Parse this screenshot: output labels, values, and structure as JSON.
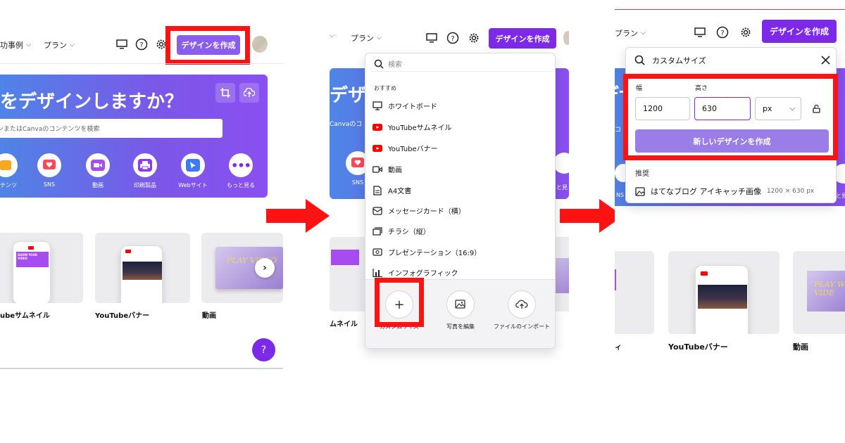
{
  "nav": {
    "success_cases": "功事例",
    "plans": "プラン",
    "create_design": "デザインを作成"
  },
  "hero": {
    "title": "何をデザインしますか？",
    "search_placeholder": "ンまたはCanvaのコンテンツを検索",
    "categories": [
      "ンテンツ",
      "SNS",
      "動画",
      "印刷製品",
      "Webサイト",
      "もっと見る"
    ]
  },
  "thumbs": {
    "youtube_thumbnail": "YouTubeサムネイル",
    "youtube_thumbnail_cut": "ubeサムネイル",
    "youtube_banner": "YouTubeバナー",
    "video": "動画",
    "play_video": "PLAY VIDEO",
    "show_your_video": "SHOW YOUR VIDEO"
  },
  "panel2": {
    "hero_title_cut": "デザ",
    "hero_search_cut": "Canvaのコ",
    "sns_label": "SNS",
    "more_cut": "と見",
    "thumb_cut": "ムネイル"
  },
  "dropdown": {
    "search_placeholder": "検索",
    "section": "おすすめ",
    "items": [
      {
        "icon": "whiteboard-icon",
        "label": "ホワイトボード"
      },
      {
        "icon": "youtube-icon",
        "label": "YouTubeサムネイル"
      },
      {
        "icon": "youtube-icon",
        "label": "YouTubeバナー"
      },
      {
        "icon": "video-icon",
        "label": "動画"
      },
      {
        "icon": "document-icon",
        "label": "A4文書"
      },
      {
        "icon": "card-icon",
        "label": "メッセージカード（横）"
      },
      {
        "icon": "flyer-icon",
        "label": "チラシ（縦）"
      },
      {
        "icon": "presentation-icon",
        "label": "プレゼンテーション（16:9）"
      },
      {
        "icon": "chart-icon",
        "label": "インフォグラフィック"
      }
    ],
    "custom_size": "カスタムサイズ",
    "edit_photo": "写真を編集",
    "import_file": "ファイルのインポート"
  },
  "custom": {
    "search_value": "カスタムサイズ",
    "width_label": "幅",
    "height_label": "高さ",
    "width_value": "1200",
    "height_value": "630",
    "unit": "px",
    "create_button": "新しいデザインを作成",
    "recommended": "推奨",
    "suggestion": "はてなブログ アイキャッチ画像",
    "suggestion_size": "1200 × 630 px"
  },
  "panel3": {
    "ns": "NS",
    "mi": "と見",
    "thumb_cut": "ル",
    "play_video_cut": "PLAY W VIDE"
  },
  "help": "?",
  "colors": {
    "accent": "#7d2ae8",
    "highlight": "#ff1212",
    "arrow": "#ff1212"
  }
}
